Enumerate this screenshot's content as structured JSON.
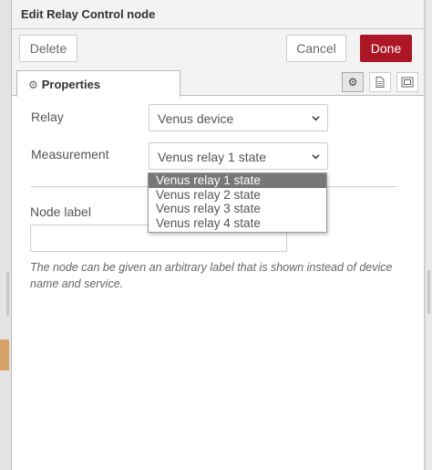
{
  "header": {
    "title": "Edit Relay Control node"
  },
  "toolbar": {
    "delete_label": "Delete",
    "cancel_label": "Cancel",
    "done_label": "Done"
  },
  "tabs": [
    {
      "label": "Properties",
      "icon": "gear-icon"
    }
  ],
  "tab_icons": [
    "gear-icon",
    "document-icon",
    "frame-icon"
  ],
  "form": {
    "relay": {
      "label": "Relay",
      "value": "Venus device"
    },
    "measurement": {
      "label": "Measurement",
      "value": "Venus relay 1 state",
      "options": [
        "Venus relay 1 state",
        "Venus relay 2 state",
        "Venus relay 3 state",
        "Venus relay 4 state"
      ]
    },
    "node_label": {
      "label": "Node label",
      "value": "",
      "placeholder": ""
    },
    "help_text": "The node can be given an arbitrary label that is shown instead of device name and service."
  },
  "colors": {
    "done_button": "#ad1625",
    "selected_option": "#777777"
  }
}
